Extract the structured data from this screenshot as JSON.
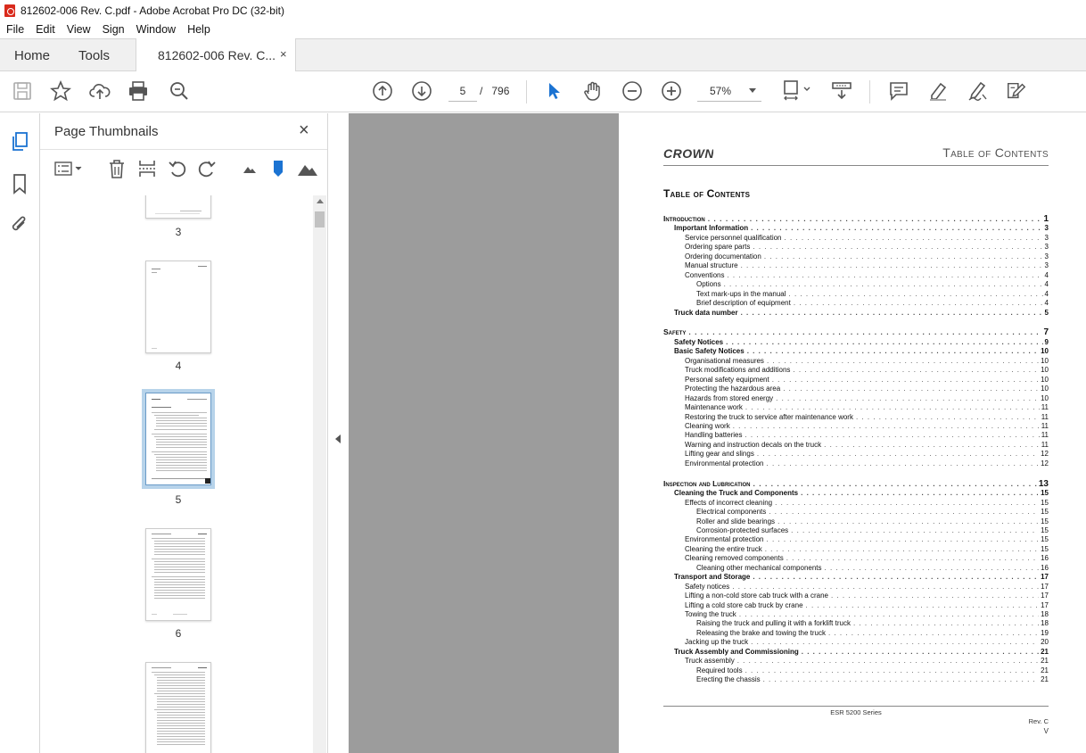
{
  "window": {
    "title": "812602-006 Rev. C.pdf - Adobe Acrobat Pro DC (32-bit)"
  },
  "menu": [
    "File",
    "Edit",
    "View",
    "Sign",
    "Window",
    "Help"
  ],
  "tabs": {
    "home": "Home",
    "tools": "Tools",
    "document": "812602-006 Rev. C...",
    "close": "×"
  },
  "toolbar": {
    "current_page": "5",
    "page_separator": "/",
    "total_pages": "796",
    "zoom": "57%"
  },
  "thumbnails": {
    "title": "Page Thumbnails",
    "close": "×",
    "pages": [
      "3",
      "4",
      "5",
      "6"
    ],
    "selected_page": "5"
  },
  "document": {
    "logo": "CROWN",
    "header_title": "Table of Contents",
    "toc_heading": "Table of Contents",
    "toc": [
      {
        "level": 1,
        "title": "Introduction",
        "page": "1"
      },
      {
        "level": 2,
        "title": "Important Information",
        "page": "3"
      },
      {
        "level": 3,
        "title": "Service personnel qualification",
        "page": "3"
      },
      {
        "level": 3,
        "title": "Ordering spare parts",
        "page": "3"
      },
      {
        "level": 3,
        "title": "Ordering documentation",
        "page": "3"
      },
      {
        "level": 3,
        "title": "Manual structure",
        "page": "3"
      },
      {
        "level": 3,
        "title": "Conventions",
        "page": "4"
      },
      {
        "level": 4,
        "title": "Options",
        "page": "4"
      },
      {
        "level": 4,
        "title": "Text mark-ups in the manual",
        "page": "4"
      },
      {
        "level": 4,
        "title": "Brief description of equipment",
        "page": "4"
      },
      {
        "level": 2,
        "title": "Truck data number",
        "page": "5"
      },
      {
        "level": 0
      },
      {
        "level": 1,
        "title": "Safety",
        "page": "7"
      },
      {
        "level": 2,
        "title": "Safety Notices",
        "page": "9"
      },
      {
        "level": 2,
        "title": "Basic Safety Notices",
        "page": "10"
      },
      {
        "level": 3,
        "title": "Organisational measures",
        "page": "10"
      },
      {
        "level": 3,
        "title": "Truck modifications and additions",
        "page": "10"
      },
      {
        "level": 3,
        "title": "Personal safety equipment",
        "page": "10"
      },
      {
        "level": 3,
        "title": "Protecting the hazardous area",
        "page": "10"
      },
      {
        "level": 3,
        "title": "Hazards from stored energy",
        "page": "10"
      },
      {
        "level": 3,
        "title": "Maintenance work",
        "page": "11"
      },
      {
        "level": 3,
        "title": "Restoring the truck to service after maintenance work",
        "page": "11"
      },
      {
        "level": 3,
        "title": "Cleaning work",
        "page": "11"
      },
      {
        "level": 3,
        "title": "Handling batteries",
        "page": "11"
      },
      {
        "level": 3,
        "title": "Warning and instruction decals on the truck",
        "page": "11"
      },
      {
        "level": 3,
        "title": "Lifting gear and slings",
        "page": "12"
      },
      {
        "level": 3,
        "title": "Environmental protection",
        "page": "12"
      },
      {
        "level": 0
      },
      {
        "level": 1,
        "title": "Inspection and Lubrication",
        "page": "13"
      },
      {
        "level": 2,
        "title": "Cleaning the Truck and Components",
        "page": "15"
      },
      {
        "level": 3,
        "title": "Effects of incorrect cleaning",
        "page": "15"
      },
      {
        "level": 4,
        "title": "Electrical components",
        "page": "15"
      },
      {
        "level": 4,
        "title": "Roller and slide bearings",
        "page": "15"
      },
      {
        "level": 4,
        "title": "Corrosion-protected surfaces",
        "page": "15"
      },
      {
        "level": 3,
        "title": "Environmental protection",
        "page": "15"
      },
      {
        "level": 3,
        "title": "Cleaning the entire truck",
        "page": "15"
      },
      {
        "level": 3,
        "title": "Cleaning removed components",
        "page": "16"
      },
      {
        "level": 4,
        "title": "Cleaning other mechanical components",
        "page": "16"
      },
      {
        "level": 2,
        "title": "Transport and Storage",
        "page": "17"
      },
      {
        "level": 3,
        "title": "Safety notices",
        "page": "17"
      },
      {
        "level": 3,
        "title": "Lifting a non-cold store cab truck with a crane",
        "page": "17"
      },
      {
        "level": 3,
        "title": "Lifting a cold store cab truck by crane",
        "page": "17"
      },
      {
        "level": 3,
        "title": "Towing the truck",
        "page": "18"
      },
      {
        "level": 4,
        "title": "Raising the truck and pulling it with a forklift truck",
        "page": "18"
      },
      {
        "level": 4,
        "title": "Releasing the brake and towing the truck",
        "page": "19"
      },
      {
        "level": 3,
        "title": "Jacking up the truck",
        "page": "20"
      },
      {
        "level": 2,
        "title": "Truck Assembly and Commissioning",
        "page": "21"
      },
      {
        "level": 3,
        "title": "Truck assembly",
        "page": "21"
      },
      {
        "level": 4,
        "title": "Required tools",
        "page": "21"
      },
      {
        "level": 4,
        "title": "Erecting the chassis",
        "page": "21"
      }
    ],
    "footer_series": "ESR 5200 Series",
    "footer_rev": "Rev. C",
    "footer_page": "V"
  }
}
